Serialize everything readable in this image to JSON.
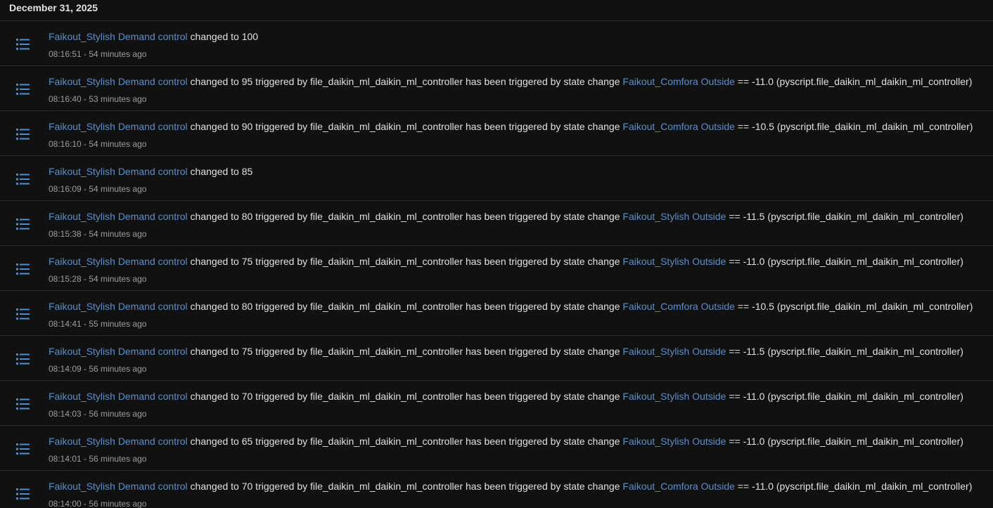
{
  "date": "December 31, 2025",
  "colors": {
    "background": "#111111",
    "link": "#5d8fc9",
    "text": "#e1e1e1",
    "secondary": "#9e9e9e",
    "icon": "#4a8fd6"
  },
  "entries": [
    {
      "entity": "Faikout_Stylish Demand control",
      "text": " changed to 100",
      "trigger_entity": "",
      "tail": "",
      "time": "08:16:51 - 54 minutes ago"
    },
    {
      "entity": "Faikout_Stylish Demand control",
      "text": " changed to 95 triggered by file_daikin_ml_daikin_ml_controller has been triggered by state change ",
      "trigger_entity": "Faikout_Comfora Outside",
      "tail": " == -11.0 (pyscript.file_daikin_ml_daikin_ml_controller)",
      "time": "08:16:40 - 53 minutes ago"
    },
    {
      "entity": "Faikout_Stylish Demand control",
      "text": " changed to 90 triggered by file_daikin_ml_daikin_ml_controller has been triggered by state change ",
      "trigger_entity": "Faikout_Comfora Outside",
      "tail": " == -10.5 (pyscript.file_daikin_ml_daikin_ml_controller)",
      "time": "08:16:10 - 54 minutes ago"
    },
    {
      "entity": "Faikout_Stylish Demand control",
      "text": " changed to 85",
      "trigger_entity": "",
      "tail": "",
      "time": "08:16:09 - 54 minutes ago"
    },
    {
      "entity": "Faikout_Stylish Demand control",
      "text": " changed to 80 triggered by file_daikin_ml_daikin_ml_controller has been triggered by state change ",
      "trigger_entity": "Faikout_Stylish Outside",
      "tail": " == -11.5 (pyscript.file_daikin_ml_daikin_ml_controller)",
      "time": "08:15:38 - 54 minutes ago"
    },
    {
      "entity": "Faikout_Stylish Demand control",
      "text": " changed to 75 triggered by file_daikin_ml_daikin_ml_controller has been triggered by state change ",
      "trigger_entity": "Faikout_Stylish Outside",
      "tail": " == -11.0 (pyscript.file_daikin_ml_daikin_ml_controller)",
      "time": "08:15:28 - 54 minutes ago"
    },
    {
      "entity": "Faikout_Stylish Demand control",
      "text": " changed to 80 triggered by file_daikin_ml_daikin_ml_controller has been triggered by state change ",
      "trigger_entity": "Faikout_Comfora Outside",
      "tail": " == -10.5 (pyscript.file_daikin_ml_daikin_ml_controller)",
      "time": "08:14:41 - 55 minutes ago"
    },
    {
      "entity": "Faikout_Stylish Demand control",
      "text": " changed to 75 triggered by file_daikin_ml_daikin_ml_controller has been triggered by state change ",
      "trigger_entity": "Faikout_Stylish Outside",
      "tail": " == -11.5 (pyscript.file_daikin_ml_daikin_ml_controller)",
      "time": "08:14:09 - 56 minutes ago"
    },
    {
      "entity": "Faikout_Stylish Demand control",
      "text": " changed to 70 triggered by file_daikin_ml_daikin_ml_controller has been triggered by state change ",
      "trigger_entity": "Faikout_Stylish Outside",
      "tail": " == -11.0 (pyscript.file_daikin_ml_daikin_ml_controller)",
      "time": "08:14:03 - 56 minutes ago"
    },
    {
      "entity": "Faikout_Stylish Demand control",
      "text": " changed to 65 triggered by file_daikin_ml_daikin_ml_controller has been triggered by state change ",
      "trigger_entity": "Faikout_Stylish Outside",
      "tail": " == -11.0 (pyscript.file_daikin_ml_daikin_ml_controller)",
      "time": "08:14:01 - 56 minutes ago"
    },
    {
      "entity": "Faikout_Stylish Demand control",
      "text": " changed to 70 triggered by file_daikin_ml_daikin_ml_controller has been triggered by state change ",
      "trigger_entity": "Faikout_Comfora Outside",
      "tail": " == -11.0 (pyscript.file_daikin_ml_daikin_ml_controller)",
      "time": "08:14:00 - 56 minutes ago"
    }
  ],
  "icon_name": "format-list-bulleted-icon"
}
